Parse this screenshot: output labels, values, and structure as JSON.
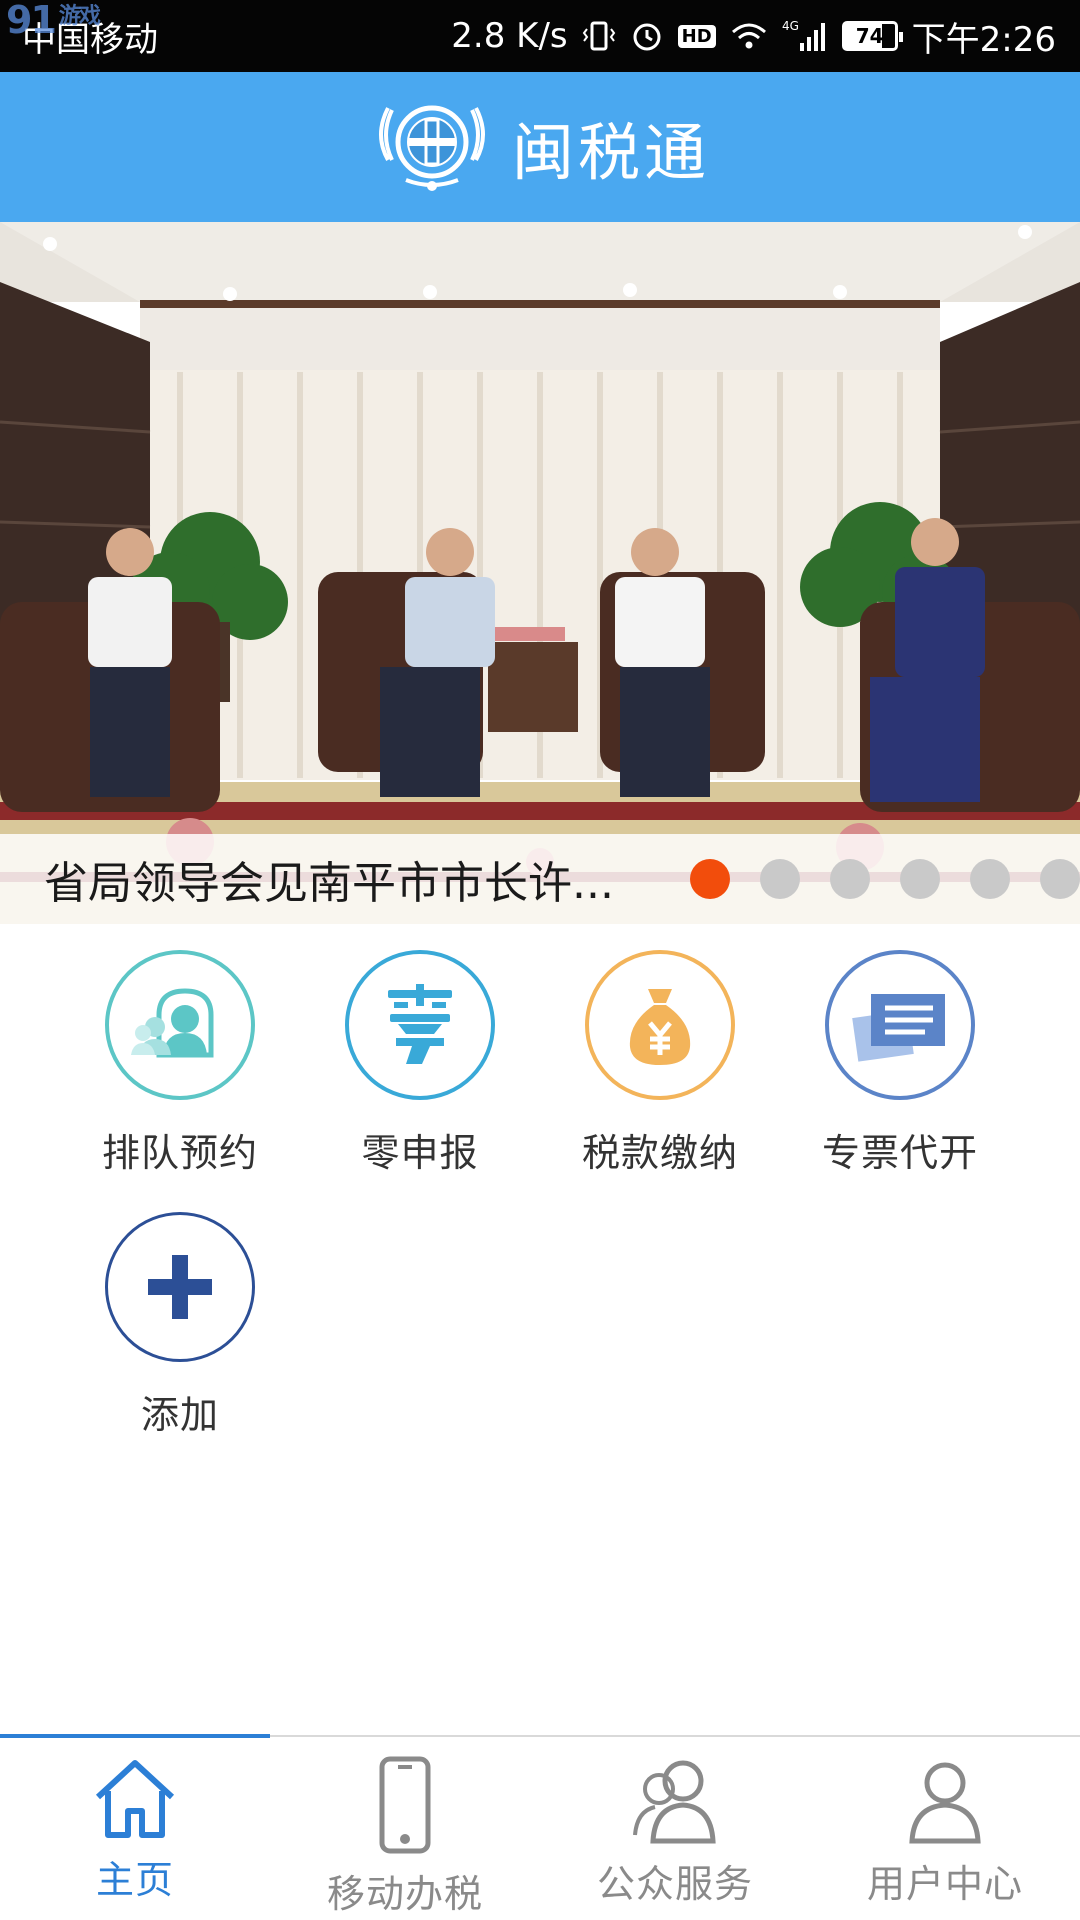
{
  "status_bar": {
    "watermark_digits": "91",
    "watermark_text": "游戏",
    "carrier": "中国移动",
    "net_speed": "2.8 K/s",
    "network_badge": "4G",
    "battery": "74",
    "time": "下午2:26"
  },
  "header": {
    "title": "闽税通"
  },
  "banner": {
    "caption": "省局领导会见南平市市长许...",
    "total_slides": 6,
    "active_slide": 1
  },
  "services": [
    {
      "label": "排队预约",
      "icon": "queue-reservation-icon",
      "color": "#5cc6c6"
    },
    {
      "label": "零申报",
      "icon": "zero-declaration-icon",
      "color": "#39a9d8"
    },
    {
      "label": "税款缴纳",
      "icon": "tax-payment-icon",
      "color": "#f3b45a"
    },
    {
      "label": "专票代开",
      "icon": "invoice-icon",
      "color": "#5b84c8"
    },
    {
      "label": "添加",
      "icon": "add-icon",
      "color": "#2c4f96"
    }
  ],
  "tabs": [
    {
      "label": "主页",
      "icon": "home-icon",
      "active": true
    },
    {
      "label": "移动办税",
      "icon": "mobile-phone-icon",
      "active": false
    },
    {
      "label": "公众服务",
      "icon": "public-service-icon",
      "active": false
    },
    {
      "label": "用户中心",
      "icon": "user-icon",
      "active": false
    }
  ],
  "colors": {
    "header": "#4aa8f0",
    "active_tab": "#2c7fd6",
    "inactive_tab": "#8a8a8a",
    "active_dot": "#f24d0c"
  }
}
